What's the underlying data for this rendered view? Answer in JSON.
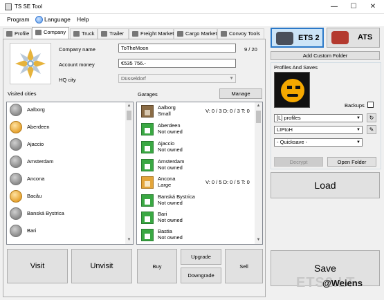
{
  "window": {
    "title": "TS SE Tool",
    "minimize": "—",
    "maximize": "☐",
    "close": "✕"
  },
  "menu": {
    "program": "Program",
    "language": "Language",
    "help": "Help"
  },
  "tabs": [
    {
      "label": "Profile"
    },
    {
      "label": "Company"
    },
    {
      "label": "Truck"
    },
    {
      "label": "Trailer"
    },
    {
      "label": "Freight Market"
    },
    {
      "label": "Cargo Market"
    },
    {
      "label": "Convoy Tools"
    }
  ],
  "company": {
    "name_label": "Company name",
    "name_value": "ToTheMoon",
    "name_counter": "9 / 20",
    "money_label": "Account money",
    "money_value": "€535 756.-",
    "hq_label": "HQ city",
    "hq_value": "Düsseldorf"
  },
  "visited_cities": {
    "label": "Visited cities",
    "items": [
      {
        "name": "Aalborg",
        "visited": false
      },
      {
        "name": "Aberdeen",
        "visited": true
      },
      {
        "name": "Ajaccio",
        "visited": false
      },
      {
        "name": "Amsterdam",
        "visited": false
      },
      {
        "name": "Ancona",
        "visited": false
      },
      {
        "name": "Bacău",
        "visited": true
      },
      {
        "name": "Banská Bystrica",
        "visited": false
      },
      {
        "name": "Bari",
        "visited": false
      }
    ]
  },
  "garages": {
    "label": "Garages",
    "manage_label": "Manage",
    "items": [
      {
        "name": "Aalborg",
        "status": "Small",
        "stats": "V: 0 / 3 D: 0 / 3 T: 0",
        "icon": "brown"
      },
      {
        "name": "Aberdeen",
        "status": "Not owned",
        "stats": "",
        "icon": "green"
      },
      {
        "name": "Ajaccio",
        "status": "Not owned",
        "stats": "",
        "icon": "green"
      },
      {
        "name": "Amsterdam",
        "status": "Not owned",
        "stats": "",
        "icon": "green"
      },
      {
        "name": "Ancona",
        "status": "Large",
        "stats": "V: 0 / 5 D: 0 / 5 T: 0",
        "icon": "owned"
      },
      {
        "name": "Banská Bystrica",
        "status": "Not owned",
        "stats": "",
        "icon": "green"
      },
      {
        "name": "Bari",
        "status": "Not owned",
        "stats": "",
        "icon": "green"
      },
      {
        "name": "Bastia",
        "status": "Not owned",
        "stats": "",
        "icon": "green"
      }
    ]
  },
  "actions": {
    "visit": "Visit",
    "unvisit": "Unvisit",
    "buy": "Buy",
    "upgrade": "Upgrade",
    "downgrade": "Downgrade",
    "sell": "Sell"
  },
  "right": {
    "ets2": "ETS 2",
    "ats": "ATS",
    "add_custom_folder": "Add Custom Folder",
    "profiles_and_saves": "Profiles And Saves",
    "backups": "Backups",
    "profiles_combo": "[L] profiles",
    "profile_combo": "LIPtoH",
    "save_combo": "- Quicksave -",
    "decrypt": "Decrypt",
    "open_folder": "Open Folder",
    "load": "Load",
    "save": "Save"
  },
  "watermark": {
    "text": "ETS2.LT",
    "user": "@Weiens"
  }
}
